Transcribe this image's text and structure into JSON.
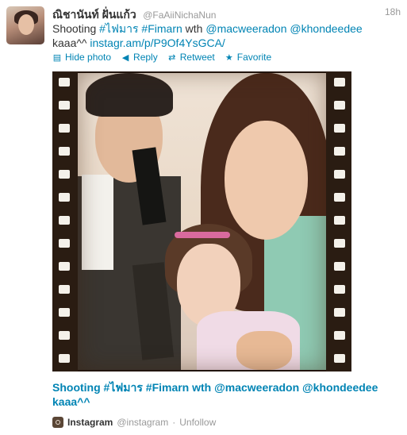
{
  "tweet": {
    "author_name": "ณิชานันท์ ฝั่นแก้ว",
    "author_handle": "@FaAiiNichaNun",
    "timestamp": "18h",
    "text_parts": {
      "p1": "Shooting ",
      "h1": "#ไฟมาร",
      "p2": " ",
      "h2": "#Fimarn",
      "p3": " wth ",
      "m1": "@macweeradon",
      "p4": " ",
      "m2": "@khondeedee",
      "p5": " kaaa^^ ",
      "url": "instagr.am/p/P9Of4YsGCA/"
    },
    "actions": {
      "hide_photo": "Hide photo",
      "reply": "Reply",
      "retweet": "Retweet",
      "favorite": "Favorite"
    },
    "media": {
      "caption": "Shooting #ไฟมาร #Fimarn wth @macweeradon @khondeedee kaaa^^",
      "source_name": "Instagram",
      "source_handle": "@instagram",
      "separator": "·",
      "unfollow": "Unfollow"
    }
  },
  "colors": {
    "link": "#0084b4",
    "text": "#333333",
    "muted": "#999999"
  },
  "icons": {
    "hide_photo": "photo-icon",
    "reply": "reply-icon",
    "retweet": "retweet-icon",
    "favorite": "star-icon",
    "source": "instagram-icon"
  }
}
